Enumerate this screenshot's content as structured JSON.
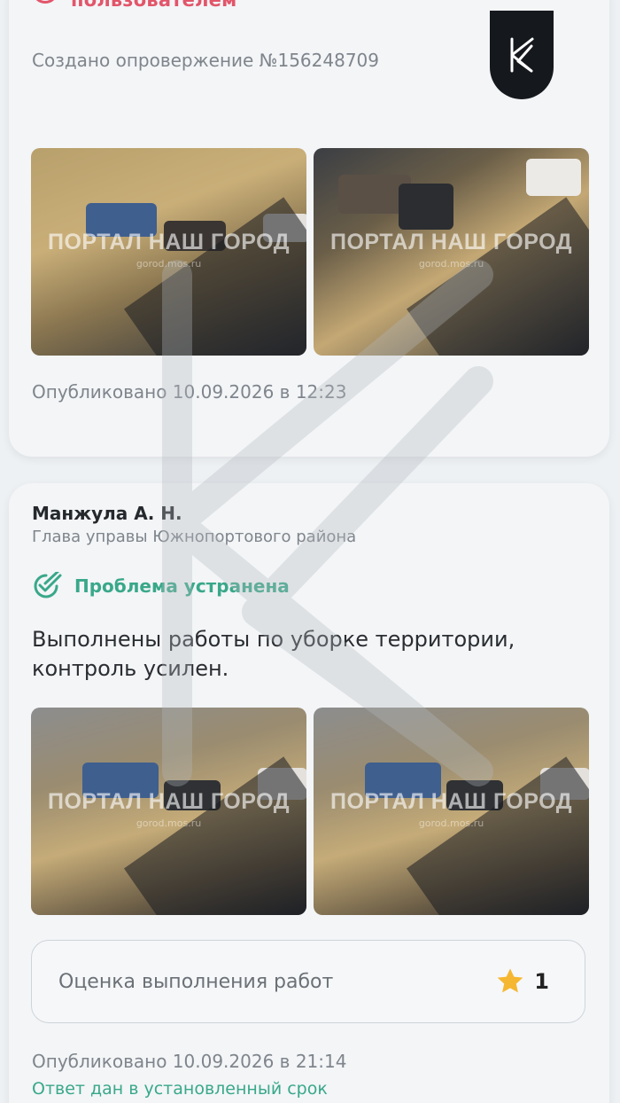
{
  "top_card": {
    "rejected_by_label": "пользователем",
    "refutation_text": "Создано опровержение №156248709",
    "photo_watermark": "ПОРТАЛ НАШ ГОРОД",
    "photo_watermark_url": "gorod.mos.ru",
    "published": "Опубликовано 10.09.2026 в 12:23"
  },
  "answer_card": {
    "author": "Манжула А. Н.",
    "position": "Глава управы Южнопортового района",
    "status": "Проблема устранена",
    "answer_text": "Выполнены работы по уборке территории, контроль усилен.",
    "photo_watermark": "ПОРТАЛ НАШ ГОРОД",
    "photo_watermark_url": "gorod.mos.ru",
    "rating_label": "Оценка выполнения работ",
    "rating_value": "1",
    "published": "Опубликовано 10.09.2026 в 21:14",
    "in_time": "Ответ дан в установленный срок"
  },
  "colors": {
    "reject": "#e2556a",
    "success": "#39a88a",
    "star": "#f5b731",
    "badge": "#15181d"
  },
  "icons": {
    "reject": "close-circle-icon",
    "status": "check-double-icon",
    "star": "star-icon",
    "brand": "brand-logo-icon"
  }
}
